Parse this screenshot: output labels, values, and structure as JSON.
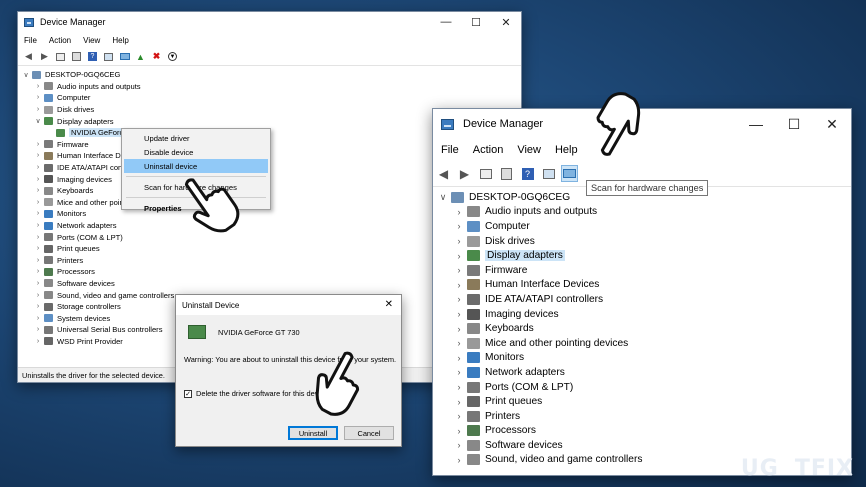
{
  "small_window": {
    "title": "Device Manager",
    "menu": [
      "File",
      "Action",
      "View",
      "Help"
    ],
    "root": "DESKTOP-0GQ6CEG",
    "items": [
      "Audio inputs and outputs",
      "Computer",
      "Disk drives",
      "Display adapters",
      "NVIDIA GeForce GT 730",
      "Firmware",
      "Human Interface Devices",
      "IDE ATA/ATAPI controllers",
      "Imaging devices",
      "Keyboards",
      "Mice and other pointing devices",
      "Monitors",
      "Network adapters",
      "Ports (COM & LPT)",
      "Print queues",
      "Printers",
      "Processors",
      "Software devices",
      "Sound, video and game controllers",
      "Storage controllers",
      "System devices",
      "Universal Serial Bus controllers",
      "WSD Print Provider"
    ],
    "status": "Uninstalls the driver for the selected device."
  },
  "context_menu": {
    "items": [
      "Update driver",
      "Disable device",
      "Uninstall device",
      "Scan for hardware changes",
      "Properties"
    ],
    "selected": "Uninstall device"
  },
  "dialog": {
    "title": "Uninstall Device",
    "device": "NVIDIA GeForce GT 730",
    "warning": "Warning: You are about to uninstall this device from your system.",
    "checkbox_label": "Delete the driver software for this device.",
    "checked": true,
    "uninstall": "Uninstall",
    "cancel": "Cancel"
  },
  "big_window": {
    "title": "Device Manager",
    "menu": [
      "File",
      "Action",
      "View",
      "Help"
    ],
    "root": "DESKTOP-0GQ6CEG",
    "tooltip": "Scan for hardware changes",
    "items": [
      "Audio inputs and outputs",
      "Computer",
      "Disk drives",
      "Display adapters",
      "Firmware",
      "Human Interface Devices",
      "IDE ATA/ATAPI controllers",
      "Imaging devices",
      "Keyboards",
      "Mice and other pointing devices",
      "Monitors",
      "Network adapters",
      "Ports (COM & LPT)",
      "Print queues",
      "Printers",
      "Processors",
      "Software devices",
      "Sound, video and game controllers"
    ],
    "highlighted": "Display adapters"
  },
  "watermark": {
    "left": "UG",
    "x": "E",
    "right": "TFIX"
  },
  "colors": {
    "selection": "#cce4f7",
    "menu_selection": "#91c9f7",
    "background": "#1d4775"
  }
}
